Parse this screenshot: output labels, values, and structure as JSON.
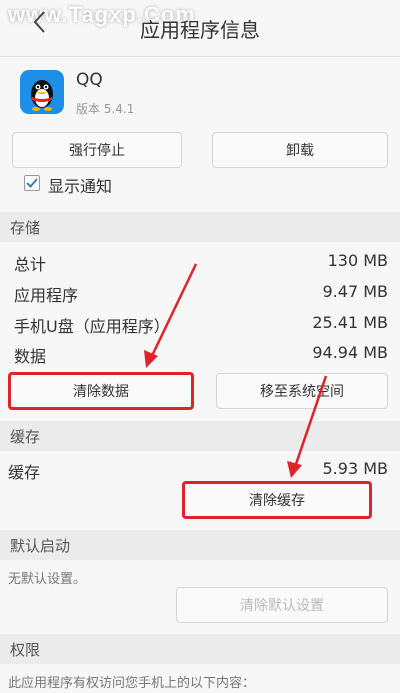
{
  "header": {
    "title": "应用程序信息",
    "back_icon": "back-arrow-icon"
  },
  "watermark": "www.Tagxp.Com",
  "app": {
    "name": "QQ",
    "version": "版本 5.4.1",
    "icon": "qq-penguin-icon"
  },
  "actions": {
    "force_stop": "强行停止",
    "uninstall": "卸载"
  },
  "notification": {
    "label": "显示通知",
    "checked": true
  },
  "storage": {
    "section": "存储",
    "rows": [
      {
        "label": "总计",
        "value": "130 MB"
      },
      {
        "label": "应用程序",
        "value": "9.47 MB"
      },
      {
        "label": "手机U盘（应用程序）",
        "value": "25.41 MB"
      },
      {
        "label": "数据",
        "value": "94.94 MB"
      }
    ],
    "clear_data": "清除数据",
    "move": "移至系统空间"
  },
  "cache": {
    "section": "缓存",
    "label": "缓存",
    "value": "5.93 MB",
    "clear_cache": "清除缓存"
  },
  "default_launch": {
    "section": "默认启动",
    "note": "无默认设置。",
    "clear_defaults": "清除默认设置"
  },
  "permissions": {
    "section": "权限",
    "note": "此应用程序有权访问您手机上的以下内容："
  },
  "colors": {
    "highlight": "#e0232b",
    "app_icon_bg": "#1e8fe6"
  }
}
